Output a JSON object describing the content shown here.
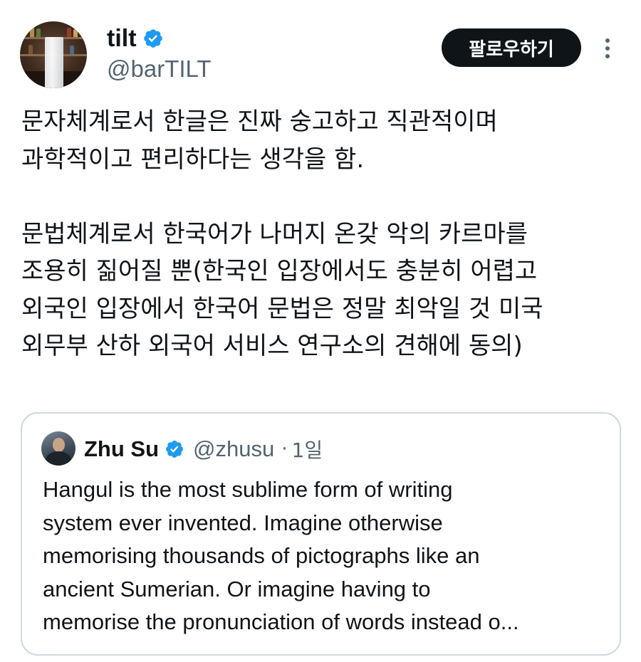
{
  "tweet": {
    "author": {
      "display_name": "tilt",
      "handle": "@barTILT",
      "verified": true
    },
    "follow_button_label": "팔로우하기",
    "more_icon": "more-vertical-icon",
    "body": "문자체계로서 한글은 진짜 숭고하고 직관적이며\n과학적이고 편리하다는 생각을 함.\n\n문법체계로서 한국어가 나머지 온갖 악의 카르마를\n조용히 짊어질 뿐(한국인 입장에서도 충분히 어렵고\n외국인 입장에서 한국어 문법은 정말 최악일 것 미국\n외무부 산하 외국어 서비스 연구소의 견해에 동의)"
  },
  "quoted_tweet": {
    "author": {
      "display_name": "Zhu Su",
      "handle": "@zhusu",
      "verified": true
    },
    "separator": "·",
    "time": "1일",
    "text": "Hangul is the most sublime form of writing\nsystem ever invented. Imagine otherwise\nmemorising thousands of pictographs like an\nancient Sumerian. Or imagine having to\nmemorise the pronunciation of words instead o..."
  },
  "colors": {
    "text_primary": "#0f1419",
    "text_secondary": "#536471",
    "verified_blue": "#1d9bf0",
    "button_bg": "#0f1419",
    "border": "#cfd9de"
  }
}
